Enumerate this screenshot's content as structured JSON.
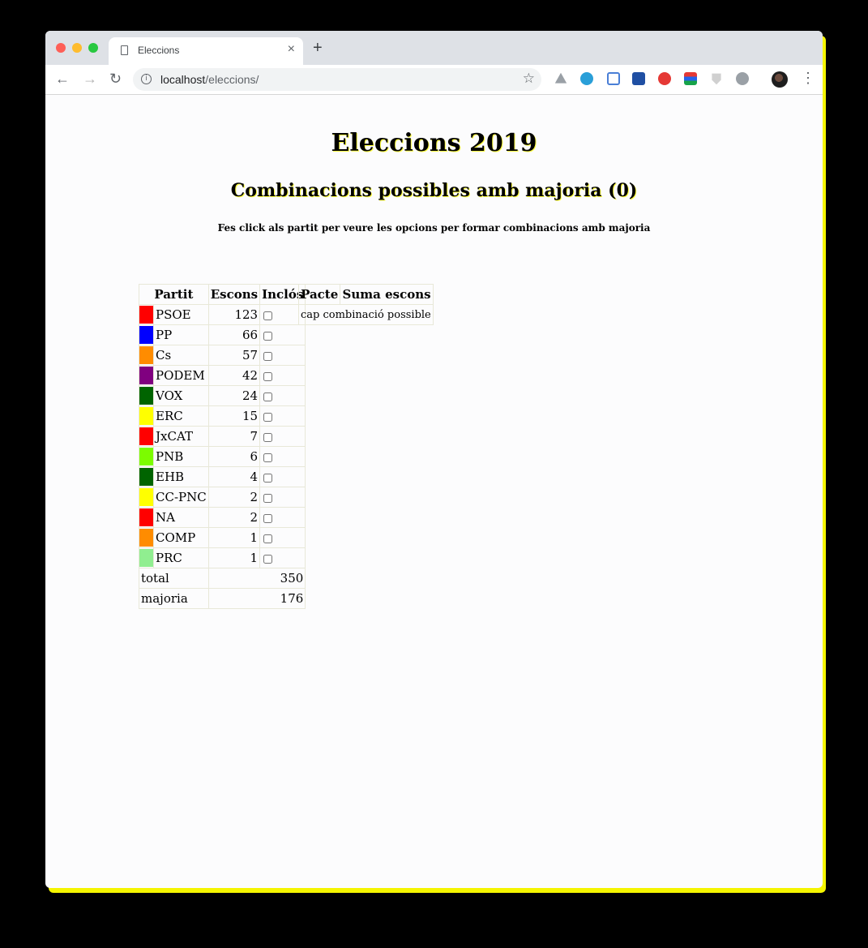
{
  "browser": {
    "tab_title": "Eleccions",
    "tab_close": "×",
    "new_tab": "+",
    "url_host": "localhost",
    "url_path": "/eleccions/"
  },
  "page": {
    "title": "Eleccions 2019",
    "subtitle": "Combinacions possibles amb majoria (0)",
    "hint": "Fes click als partit per veure les opcions per formar combinacions amb majoria"
  },
  "parties_table": {
    "headers": [
      "Partit",
      "Escons",
      "Inclós"
    ],
    "rows": [
      {
        "name": "PSOE",
        "seats": "123",
        "color": "#ff0000"
      },
      {
        "name": "PP",
        "seats": "66",
        "color": "#0000ff"
      },
      {
        "name": "Cs",
        "seats": "57",
        "color": "#ff8c00"
      },
      {
        "name": "PODEM",
        "seats": "42",
        "color": "#800080"
      },
      {
        "name": "VOX",
        "seats": "24",
        "color": "#006400"
      },
      {
        "name": "ERC",
        "seats": "15",
        "color": "#ffff00"
      },
      {
        "name": "JxCAT",
        "seats": "7",
        "color": "#ff0000"
      },
      {
        "name": "PNB",
        "seats": "6",
        "color": "#7cfc00"
      },
      {
        "name": "EHB",
        "seats": "4",
        "color": "#006400"
      },
      {
        "name": "CC-PNC",
        "seats": "2",
        "color": "#ffff00"
      },
      {
        "name": "NA",
        "seats": "2",
        "color": "#ff0000"
      },
      {
        "name": "COMP",
        "seats": "1",
        "color": "#ff8c00"
      },
      {
        "name": "PRC",
        "seats": "1",
        "color": "#90ee90"
      }
    ],
    "total_label": "total",
    "total_value": "350",
    "majority_label": "majoria",
    "majority_value": "176"
  },
  "pacts_table": {
    "headers": [
      "Pacte",
      "Suma escons"
    ],
    "empty_text": "cap combinació possible"
  }
}
